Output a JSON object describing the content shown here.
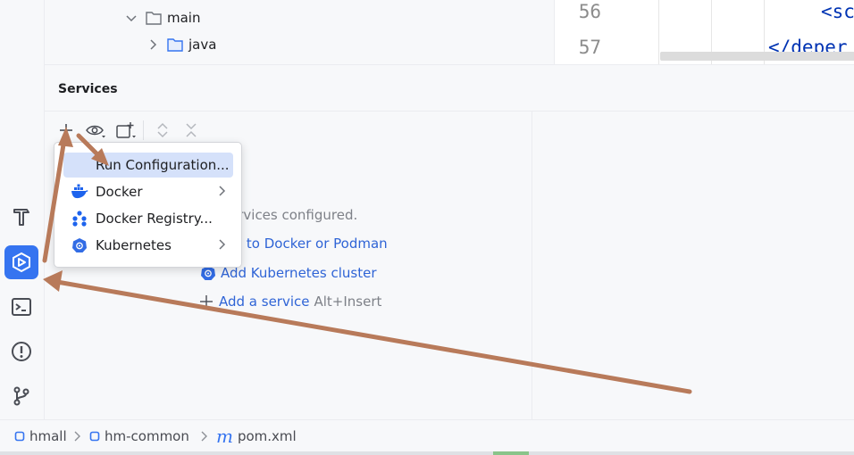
{
  "project_tree": {
    "items": [
      {
        "label": "main",
        "expanded": true
      },
      {
        "label": "java",
        "expanded": false
      }
    ]
  },
  "editor": {
    "lines": [
      {
        "number": "56",
        "code": "<sc"
      },
      {
        "number": "57",
        "code": "</deper"
      }
    ]
  },
  "services": {
    "title": "Services",
    "empty_text": "ervices configured.",
    "links": {
      "connect": "ct to Docker or Podman",
      "add_k8s": "Add Kubernetes cluster",
      "add_service": "Add a service",
      "add_service_hint": "Alt+Insert"
    },
    "menu": {
      "items": [
        {
          "label": "Run Configuration...",
          "icon": "none",
          "selected": true,
          "submenu": false
        },
        {
          "label": "Docker",
          "icon": "docker-icon",
          "selected": false,
          "submenu": true
        },
        {
          "label": "Docker Registry...",
          "icon": "docker-registry-icon",
          "selected": false,
          "submenu": false
        },
        {
          "label": "Kubernetes",
          "icon": "kubernetes-icon",
          "selected": false,
          "submenu": true
        }
      ]
    }
  },
  "breadcrumb": {
    "items": [
      "hmall",
      "hm-common",
      "pom.xml"
    ]
  },
  "colors": {
    "accent": "#3574f0",
    "link": "#2f64d6",
    "annotation_arrow": "#b87a5a",
    "menu_selection": "#d5e1fa"
  }
}
